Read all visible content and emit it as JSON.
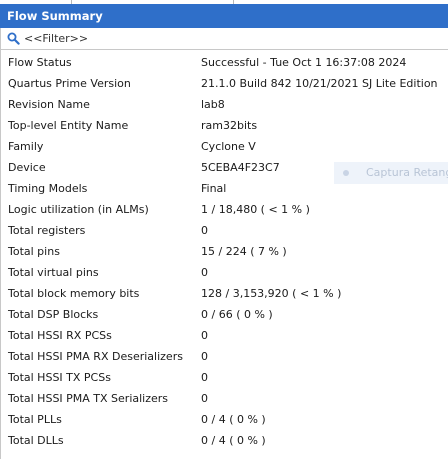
{
  "panel": {
    "title": "Flow Summary"
  },
  "filter": {
    "placeholder": "<<Filter>>"
  },
  "summary": {
    "rows": [
      {
        "key": "Flow Status",
        "value": "Successful - Tue Oct  1 16:37:08 2024"
      },
      {
        "key": "Quartus Prime Version",
        "value": "21.1.0 Build 842 10/21/2021 SJ Lite Edition"
      },
      {
        "key": "Revision Name",
        "value": "lab8"
      },
      {
        "key": "Top-level Entity Name",
        "value": "ram32bits"
      },
      {
        "key": "Family",
        "value": "Cyclone V"
      },
      {
        "key": "Device",
        "value": "5CEBA4F23C7"
      },
      {
        "key": "Timing Models",
        "value": "Final"
      },
      {
        "key": "Logic utilization (in ALMs)",
        "value": "1 / 18,480 ( < 1 % )"
      },
      {
        "key": "Total registers",
        "value": "0"
      },
      {
        "key": "Total pins",
        "value": "15 / 224 ( 7 % )"
      },
      {
        "key": "Total virtual pins",
        "value": "0"
      },
      {
        "key": "Total block memory bits",
        "value": "128 / 3,153,920 ( < 1 % )"
      },
      {
        "key": "Total DSP Blocks",
        "value": "0 / 66 ( 0 % )"
      },
      {
        "key": "Total HSSI RX PCSs",
        "value": "0"
      },
      {
        "key": "Total HSSI PMA RX Deserializers",
        "value": "0"
      },
      {
        "key": "Total HSSI TX PCSs",
        "value": "0"
      },
      {
        "key": "Total HSSI PMA TX Serializers",
        "value": "0"
      },
      {
        "key": "Total PLLs",
        "value": "0 / 4 ( 0 % )"
      },
      {
        "key": "Total DLLs",
        "value": "0 / 4 ( 0 % )"
      }
    ]
  },
  "overlay": {
    "label": "Captura Retang"
  },
  "colors": {
    "title_bar": "#2f6fc9",
    "search_icon": "#2f6fc9"
  },
  "icons": {
    "search": "search-icon"
  }
}
